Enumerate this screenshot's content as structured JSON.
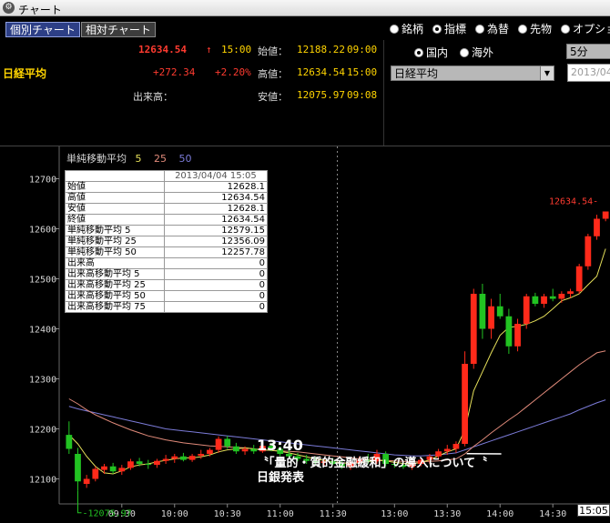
{
  "window": {
    "title": "チャート",
    "icon": "app-icon"
  },
  "tabs": [
    {
      "label": "個別チャート",
      "active": true
    },
    {
      "label": "相対チャート",
      "active": false
    }
  ],
  "quote": {
    "name": "日経平均",
    "price": "12634.54",
    "arrow": "↑",
    "time": "15:00",
    "change": "+272.34",
    "change_pct": "+2.20%",
    "volume_label": "出来高：",
    "open_label": "始値：",
    "open_value": "12188.22",
    "open_time": "09:00",
    "high_label": "高値：",
    "high_value": "12634.54",
    "high_time": "15:00",
    "low_label": "安値：",
    "low_value": "12075.97",
    "low_time": "09:08"
  },
  "radios_top": [
    {
      "label": "銘柄",
      "selected": false
    },
    {
      "label": "指標",
      "selected": true
    },
    {
      "label": "為替",
      "selected": false
    },
    {
      "label": "先物",
      "selected": false
    },
    {
      "label": "オプション",
      "selected": false
    }
  ],
  "radios_region": [
    {
      "label": "国内",
      "selected": true
    },
    {
      "label": "海外",
      "selected": false
    }
  ],
  "index_select": {
    "value": "日経平均"
  },
  "interval_select": {
    "value": "5分"
  },
  "date_input": {
    "value": "2013/04/04"
  },
  "legend": {
    "title": "単純移動平均",
    "ma1": "5",
    "ma2": "25",
    "ma3": "50",
    "ma1_color": "#e6e05a",
    "ma2_color": "#e08a7a",
    "ma3_color": "#7b7bd8"
  },
  "info_table": {
    "timestamp": "2013/04/04 15:05",
    "rows": [
      {
        "label": "始値",
        "value": "12628.1"
      },
      {
        "label": "高値",
        "value": "12634.54"
      },
      {
        "label": "安値",
        "value": "12628.1"
      },
      {
        "label": "終値",
        "value": "12634.54"
      },
      {
        "label": "単純移動平均 5",
        "value": "12579.15"
      },
      {
        "label": "単純移動平均 25",
        "value": "12356.09"
      },
      {
        "label": "単純移動平均 50",
        "value": "12257.78"
      },
      {
        "label": "出来高",
        "value": "0"
      },
      {
        "label": "出来高移動平均 5",
        "value": "0"
      },
      {
        "label": "出来高移動平均 25",
        "value": "0"
      },
      {
        "label": "出来高移動平均 50",
        "value": "0"
      },
      {
        "label": "出来高移動平均 75",
        "value": "0"
      }
    ]
  },
  "annotation": {
    "time": "13:40",
    "text": "〝「量的・質的金融緩和」の導入について〝",
    "source": "日銀発表"
  },
  "current_time_badge": "15:05",
  "chart_data": {
    "type": "candlestick",
    "ylim": [
      12050,
      12750
    ],
    "y_ticks": [
      12100,
      12200,
      12300,
      12400,
      12500,
      12600,
      12700
    ],
    "x_ticks": [
      "09:30",
      "10:00",
      "10:30",
      "11:00",
      "11:30",
      "12:00",
      "13:00",
      "13:30",
      "14:00",
      "14:30"
    ],
    "high_label": "12634.54",
    "low_label": "12075.97",
    "up_color": "#ff2a1a",
    "down_color": "#22c322",
    "candles": [
      [
        "09:00",
        12188,
        12215,
        12150,
        12160
      ],
      [
        "09:05",
        12150,
        12162,
        12076,
        12095
      ],
      [
        "09:10",
        12090,
        12108,
        12082,
        12100
      ],
      [
        "09:15",
        12100,
        12125,
        12095,
        12120
      ],
      [
        "09:20",
        12118,
        12130,
        12110,
        12125
      ],
      [
        "09:25",
        12125,
        12132,
        12110,
        12115
      ],
      [
        "09:30",
        12115,
        12128,
        12108,
        12122
      ],
      [
        "09:35",
        12122,
        12140,
        12118,
        12135
      ],
      [
        "09:40",
        12135,
        12142,
        12125,
        12130
      ],
      [
        "09:45",
        12130,
        12138,
        12120,
        12128
      ],
      [
        "09:50",
        12128,
        12140,
        12122,
        12136
      ],
      [
        "09:55",
        12136,
        12148,
        12130,
        12140
      ],
      [
        "10:00",
        12140,
        12150,
        12132,
        12145
      ],
      [
        "10:05",
        12145,
        12152,
        12135,
        12138
      ],
      [
        "10:10",
        12138,
        12150,
        12134,
        12146
      ],
      [
        "10:15",
        12146,
        12158,
        12140,
        12150
      ],
      [
        "10:20",
        12150,
        12162,
        12145,
        12158
      ],
      [
        "10:25",
        12158,
        12185,
        12152,
        12180
      ],
      [
        "10:30",
        12180,
        12186,
        12160,
        12165
      ],
      [
        "10:35",
        12165,
        12172,
        12150,
        12155
      ],
      [
        "10:40",
        12155,
        12165,
        12148,
        12160
      ],
      [
        "10:45",
        12160,
        12168,
        12150,
        12155
      ],
      [
        "10:50",
        12155,
        12170,
        12152,
        12166
      ],
      [
        "10:55",
        12166,
        12172,
        12155,
        12160
      ],
      [
        "11:00",
        12160,
        12165,
        12145,
        12150
      ],
      [
        "11:05",
        12150,
        12160,
        12140,
        12145
      ],
      [
        "11:10",
        12145,
        12152,
        12135,
        12140
      ],
      [
        "11:15",
        12140,
        12148,
        12130,
        12136
      ],
      [
        "11:20",
        12136,
        12145,
        12128,
        12132
      ],
      [
        "11:25",
        12132,
        12140,
        12125,
        12135
      ],
      [
        "11:30",
        12135,
        12142,
        12128,
        12130
      ],
      [
        "12:30",
        12130,
        12140,
        12120,
        12125
      ],
      [
        "12:35",
        12125,
        12138,
        12118,
        12132
      ],
      [
        "12:40",
        12132,
        12145,
        12126,
        12138
      ],
      [
        "12:45",
        12138,
        12150,
        12130,
        12135
      ],
      [
        "12:50",
        12135,
        12158,
        12130,
        12150
      ],
      [
        "12:55",
        12150,
        12155,
        12125,
        12130
      ],
      [
        "13:00",
        12130,
        12138,
        12122,
        12128
      ],
      [
        "13:05",
        12128,
        12135,
        12120,
        12124
      ],
      [
        "13:10",
        12124,
        12136,
        12118,
        12130
      ],
      [
        "13:15",
        12130,
        12142,
        12125,
        12138
      ],
      [
        "13:20",
        12138,
        12150,
        12130,
        12145
      ],
      [
        "13:25",
        12145,
        12160,
        12138,
        12155
      ],
      [
        "13:30",
        12155,
        12168,
        12148,
        12160
      ],
      [
        "13:35",
        12160,
        12175,
        12152,
        12170
      ],
      [
        "13:40",
        12170,
        12355,
        12165,
        12330
      ],
      [
        "13:45",
        12330,
        12480,
        12320,
        12470
      ],
      [
        "13:50",
        12470,
        12490,
        12380,
        12400
      ],
      [
        "13:55",
        12400,
        12460,
        12380,
        12445
      ],
      [
        "14:00",
        12445,
        12470,
        12420,
        12425
      ],
      [
        "14:05",
        12425,
        12440,
        12350,
        12365
      ],
      [
        "14:10",
        12365,
        12420,
        12355,
        12410
      ],
      [
        "14:15",
        12410,
        12470,
        12400,
        12465
      ],
      [
        "14:20",
        12465,
        12472,
        12445,
        12450
      ],
      [
        "14:25",
        12450,
        12470,
        12442,
        12465
      ],
      [
        "14:30",
        12465,
        12480,
        12455,
        12460
      ],
      [
        "14:35",
        12460,
        12475,
        12452,
        12470
      ],
      [
        "14:40",
        12470,
        12480,
        12462,
        12475
      ],
      [
        "14:45",
        12475,
        12530,
        12470,
        12525
      ],
      [
        "14:50",
        12525,
        12590,
        12518,
        12585
      ],
      [
        "14:55",
        12585,
        12628,
        12578,
        12620
      ],
      [
        "15:00",
        12620,
        12634.54,
        12615,
        12634.54
      ]
    ],
    "ma5": [
      12188,
      12170,
      12145,
      12125,
      12112,
      12110,
      12116,
      12124,
      12128,
      12130,
      12134,
      12137,
      12140,
      12142,
      12142,
      12144,
      12148,
      12154,
      12158,
      12160,
      12162,
      12160,
      12158,
      12157,
      12155,
      12152,
      12148,
      12144,
      12140,
      12137,
      12134,
      12132,
      12131,
      12132,
      12134,
      12137,
      12136,
      12133,
      12131,
      12130,
      12133,
      12138,
      12146,
      12154,
      12160,
      12198,
      12276,
      12314,
      12352,
      12387,
      12403,
      12405,
      12409,
      12416,
      12425,
      12440,
      12456,
      12462,
      12470,
      12488,
      12505,
      12560
    ],
    "ma25": [
      12260,
      12250,
      12238,
      12228,
      12220,
      12212,
      12205,
      12198,
      12192,
      12186,
      12182,
      12178,
      12175,
      12172,
      12170,
      12168,
      12166,
      12165,
      12164,
      12163,
      12162,
      12160,
      12158,
      12157,
      12156,
      12155,
      12154,
      12152,
      12150,
      12148,
      12146,
      12144,
      12142,
      12140,
      12139,
      12138,
      12137,
      12136,
      12135,
      12134,
      12134,
      12135,
      12136,
      12138,
      12140,
      12150,
      12165,
      12178,
      12192,
      12205,
      12218,
      12230,
      12244,
      12258,
      12272,
      12286,
      12300,
      12314,
      12328,
      12340,
      12352,
      12356
    ],
    "ma50": [
      12245,
      12240,
      12236,
      12232,
      12228,
      12224,
      12220,
      12216,
      12212,
      12208,
      12204,
      12200,
      12198,
      12196,
      12194,
      12192,
      12190,
      12188,
      12186,
      12184,
      12182,
      12180,
      12178,
      12176,
      12174,
      12172,
      12170,
      12168,
      12166,
      12164,
      12162,
      12160,
      12158,
      12156,
      12154,
      12152,
      12150,
      12148,
      12147,
      12146,
      12146,
      12147,
      12148,
      12150,
      12152,
      12158,
      12164,
      12170,
      12176,
      12182,
      12188,
      12194,
      12200,
      12206,
      12212,
      12218,
      12224,
      12230,
      12238,
      12245,
      12252,
      12258
    ]
  }
}
